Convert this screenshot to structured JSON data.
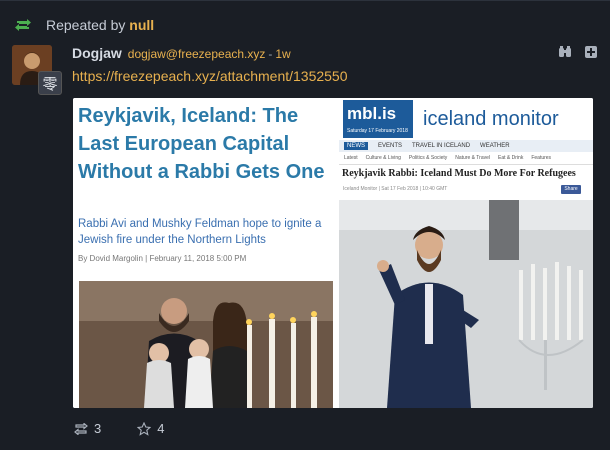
{
  "repeat": {
    "prefix": "Repeated by",
    "user": "null"
  },
  "notice": {
    "author_name": "Dogjaw",
    "author_handle": "dogjaw@freezepeach.xyz",
    "separator": "-",
    "time_ago": "1w",
    "link": "https://freezepeach.xyz/attachment/1352550",
    "avatar_badge": "零"
  },
  "attachment": {
    "left": {
      "headline": "Reykjavik, Iceland: The Last European Capital Without a Rabbi Gets One",
      "subheadline": "Rabbi Avi and Mushky Feldman hope to ignite a Jewish fire under the Northern Lights",
      "byline": "By Dovid Margolin   |   February 11, 2018 5:00 PM"
    },
    "right": {
      "logo": "mbl.is",
      "logo_date": "Saturday 17 February 2018",
      "title": "iceland monitor",
      "nav": [
        "NEWS",
        "EVENTS",
        "TRAVEL IN ICELAND",
        "WEATHER"
      ],
      "subnav": [
        "Latest",
        "Culture & Living",
        "Politics & Society",
        "Nature & Travel",
        "Eat & Drink",
        "Features"
      ],
      "headline": "Reykjavik Rabbi: Iceland Must Do More For Refugees",
      "meta": "Iceland Monitor | Sat 17 Feb 2018 | 10:40 GMT",
      "share": "Share"
    }
  },
  "footer": {
    "repeats": "3",
    "favorites": "4"
  },
  "colors": {
    "accent": "#e8b14f",
    "background": "#1a1e25",
    "repeat_green": "#4caf50"
  }
}
